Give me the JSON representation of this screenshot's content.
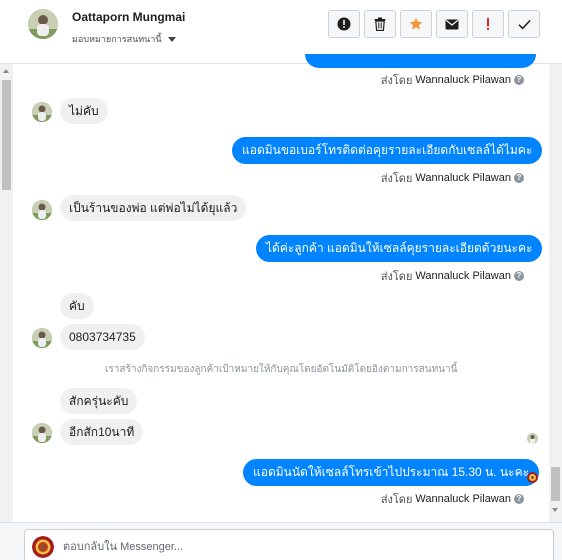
{
  "header": {
    "contact_name": "Oattaporn Mungmai",
    "assign_label": "มอบหมายการสนทนานี้",
    "tools": [
      {
        "name": "alert-icon",
        "label": "!"
      },
      {
        "name": "trash-icon",
        "label": ""
      },
      {
        "name": "star-icon",
        "label": ""
      },
      {
        "name": "envelope-icon",
        "label": ""
      },
      {
        "name": "spam-icon",
        "label": "!"
      },
      {
        "name": "checkmark-icon",
        "label": ""
      }
    ]
  },
  "messages": [
    {
      "sent_by_label": "ส่งโดย",
      "sent_by_name": "Wannaluck Pilawan"
    },
    {
      "text": "ไม่คับ"
    },
    {
      "text": "แอดมินขอเบอร์โทรติดต่อคุยรายละเอียดกับเซลล์ได้ไมคะ",
      "sent_by_label": "ส่งโดย",
      "sent_by_name": "Wannaluck Pilawan"
    },
    {
      "text": "เป็นร้านของพ่อ แต่พ่อไม่ได้ยุแล้ว"
    },
    {
      "text": "ได้ค่ะลูกค้า แอดมินให้เซลล์คุยรายละเอียดด้วยนะคะ",
      "sent_by_label": "ส่งโดย",
      "sent_by_name": "Wannaluck Pilawan"
    },
    {
      "text": "คับ"
    },
    {
      "text": "0803734735"
    },
    {
      "text": "เราสร้างกิจกรรมของลูกค้าเป้าหมายให้กับคุณโดยอัตโนมัติโดยอิงตามการสนทนานี้"
    },
    {
      "text": "สักครุ่นะคับ"
    },
    {
      "text": "อีกสัก10นาที"
    },
    {
      "text": "แอดมินนัดให้เซลล์โทรเข้าไปประมาณ  15.30 น.  นะคะ",
      "sent_by_label": "ส่งโดย",
      "sent_by_name": "Wannaluck Pilawan"
    }
  ],
  "composer": {
    "placeholder": "ตอบกลับใน Messenger..."
  },
  "colors": {
    "outgoing_bubble": "#0084ff",
    "incoming_bubble": "#f1f0f0",
    "star": "#f7923b",
    "spam": "#e02b2b"
  }
}
